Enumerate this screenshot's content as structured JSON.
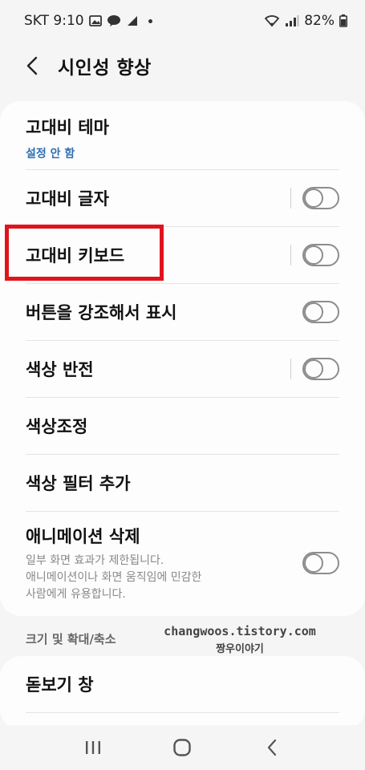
{
  "status_bar": {
    "carrier_time": "SKT 9:10",
    "battery": "82%"
  },
  "header": {
    "title": "시인성 향상"
  },
  "settings": [
    {
      "title": "고대비 테마",
      "subtitle": "설정 안 함"
    },
    {
      "title": "고대비 글자",
      "toggle": false
    },
    {
      "title": "고대비 키보드",
      "toggle": false
    },
    {
      "title": "버튼을 강조해서 표시",
      "toggle": false
    },
    {
      "title": "색상 반전",
      "toggle": false
    },
    {
      "title": "색상조정"
    },
    {
      "title": "색상 필터 추가"
    },
    {
      "title": "애니메이션 삭제",
      "desc1": "일부 화면 효과가 제한됩니다.",
      "desc2": "애니메이션이나 화면 움직임에 민감한",
      "desc3": "사람에게 유용합니다.",
      "toggle": false
    }
  ],
  "section": {
    "label": "크기 및 확대/축소"
  },
  "watermark": {
    "line1": "changwoos.tistory.com",
    "line2": "짱우이야기"
  },
  "second_card": {
    "item": "돋보기 창"
  },
  "colors": {
    "highlight": "#e0141c",
    "subtitle": "#2f6fb2"
  }
}
